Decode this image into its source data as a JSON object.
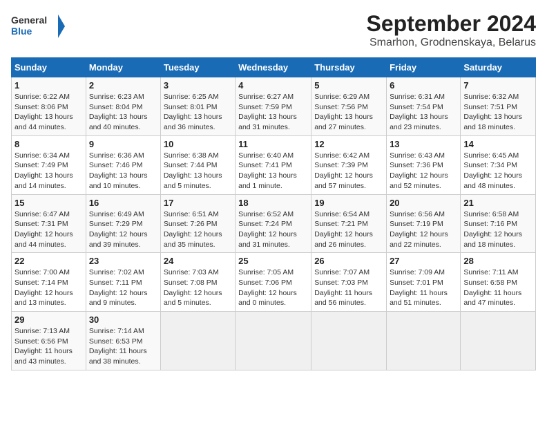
{
  "logo": {
    "line1": "General",
    "line2": "Blue"
  },
  "title": "September 2024",
  "subtitle": "Smarhon, Grodnenskaya, Belarus",
  "headers": [
    "Sunday",
    "Monday",
    "Tuesday",
    "Wednesday",
    "Thursday",
    "Friday",
    "Saturday"
  ],
  "weeks": [
    [
      {
        "day": "1",
        "sunrise": "Sunrise: 6:22 AM",
        "sunset": "Sunset: 8:06 PM",
        "daylight": "Daylight: 13 hours and 44 minutes."
      },
      {
        "day": "2",
        "sunrise": "Sunrise: 6:23 AM",
        "sunset": "Sunset: 8:04 PM",
        "daylight": "Daylight: 13 hours and 40 minutes."
      },
      {
        "day": "3",
        "sunrise": "Sunrise: 6:25 AM",
        "sunset": "Sunset: 8:01 PM",
        "daylight": "Daylight: 13 hours and 36 minutes."
      },
      {
        "day": "4",
        "sunrise": "Sunrise: 6:27 AM",
        "sunset": "Sunset: 7:59 PM",
        "daylight": "Daylight: 13 hours and 31 minutes."
      },
      {
        "day": "5",
        "sunrise": "Sunrise: 6:29 AM",
        "sunset": "Sunset: 7:56 PM",
        "daylight": "Daylight: 13 hours and 27 minutes."
      },
      {
        "day": "6",
        "sunrise": "Sunrise: 6:31 AM",
        "sunset": "Sunset: 7:54 PM",
        "daylight": "Daylight: 13 hours and 23 minutes."
      },
      {
        "day": "7",
        "sunrise": "Sunrise: 6:32 AM",
        "sunset": "Sunset: 7:51 PM",
        "daylight": "Daylight: 13 hours and 18 minutes."
      }
    ],
    [
      {
        "day": "8",
        "sunrise": "Sunrise: 6:34 AM",
        "sunset": "Sunset: 7:49 PM",
        "daylight": "Daylight: 13 hours and 14 minutes."
      },
      {
        "day": "9",
        "sunrise": "Sunrise: 6:36 AM",
        "sunset": "Sunset: 7:46 PM",
        "daylight": "Daylight: 13 hours and 10 minutes."
      },
      {
        "day": "10",
        "sunrise": "Sunrise: 6:38 AM",
        "sunset": "Sunset: 7:44 PM",
        "daylight": "Daylight: 13 hours and 5 minutes."
      },
      {
        "day": "11",
        "sunrise": "Sunrise: 6:40 AM",
        "sunset": "Sunset: 7:41 PM",
        "daylight": "Daylight: 13 hours and 1 minute."
      },
      {
        "day": "12",
        "sunrise": "Sunrise: 6:42 AM",
        "sunset": "Sunset: 7:39 PM",
        "daylight": "Daylight: 12 hours and 57 minutes."
      },
      {
        "day": "13",
        "sunrise": "Sunrise: 6:43 AM",
        "sunset": "Sunset: 7:36 PM",
        "daylight": "Daylight: 12 hours and 52 minutes."
      },
      {
        "day": "14",
        "sunrise": "Sunrise: 6:45 AM",
        "sunset": "Sunset: 7:34 PM",
        "daylight": "Daylight: 12 hours and 48 minutes."
      }
    ],
    [
      {
        "day": "15",
        "sunrise": "Sunrise: 6:47 AM",
        "sunset": "Sunset: 7:31 PM",
        "daylight": "Daylight: 12 hours and 44 minutes."
      },
      {
        "day": "16",
        "sunrise": "Sunrise: 6:49 AM",
        "sunset": "Sunset: 7:29 PM",
        "daylight": "Daylight: 12 hours and 39 minutes."
      },
      {
        "day": "17",
        "sunrise": "Sunrise: 6:51 AM",
        "sunset": "Sunset: 7:26 PM",
        "daylight": "Daylight: 12 hours and 35 minutes."
      },
      {
        "day": "18",
        "sunrise": "Sunrise: 6:52 AM",
        "sunset": "Sunset: 7:24 PM",
        "daylight": "Daylight: 12 hours and 31 minutes."
      },
      {
        "day": "19",
        "sunrise": "Sunrise: 6:54 AM",
        "sunset": "Sunset: 7:21 PM",
        "daylight": "Daylight: 12 hours and 26 minutes."
      },
      {
        "day": "20",
        "sunrise": "Sunrise: 6:56 AM",
        "sunset": "Sunset: 7:19 PM",
        "daylight": "Daylight: 12 hours and 22 minutes."
      },
      {
        "day": "21",
        "sunrise": "Sunrise: 6:58 AM",
        "sunset": "Sunset: 7:16 PM",
        "daylight": "Daylight: 12 hours and 18 minutes."
      }
    ],
    [
      {
        "day": "22",
        "sunrise": "Sunrise: 7:00 AM",
        "sunset": "Sunset: 7:14 PM",
        "daylight": "Daylight: 12 hours and 13 minutes."
      },
      {
        "day": "23",
        "sunrise": "Sunrise: 7:02 AM",
        "sunset": "Sunset: 7:11 PM",
        "daylight": "Daylight: 12 hours and 9 minutes."
      },
      {
        "day": "24",
        "sunrise": "Sunrise: 7:03 AM",
        "sunset": "Sunset: 7:08 PM",
        "daylight": "Daylight: 12 hours and 5 minutes."
      },
      {
        "day": "25",
        "sunrise": "Sunrise: 7:05 AM",
        "sunset": "Sunset: 7:06 PM",
        "daylight": "Daylight: 12 hours and 0 minutes."
      },
      {
        "day": "26",
        "sunrise": "Sunrise: 7:07 AM",
        "sunset": "Sunset: 7:03 PM",
        "daylight": "Daylight: 11 hours and 56 minutes."
      },
      {
        "day": "27",
        "sunrise": "Sunrise: 7:09 AM",
        "sunset": "Sunset: 7:01 PM",
        "daylight": "Daylight: 11 hours and 51 minutes."
      },
      {
        "day": "28",
        "sunrise": "Sunrise: 7:11 AM",
        "sunset": "Sunset: 6:58 PM",
        "daylight": "Daylight: 11 hours and 47 minutes."
      }
    ],
    [
      {
        "day": "29",
        "sunrise": "Sunrise: 7:13 AM",
        "sunset": "Sunset: 6:56 PM",
        "daylight": "Daylight: 11 hours and 43 minutes."
      },
      {
        "day": "30",
        "sunrise": "Sunrise: 7:14 AM",
        "sunset": "Sunset: 6:53 PM",
        "daylight": "Daylight: 11 hours and 38 minutes."
      },
      null,
      null,
      null,
      null,
      null
    ]
  ]
}
